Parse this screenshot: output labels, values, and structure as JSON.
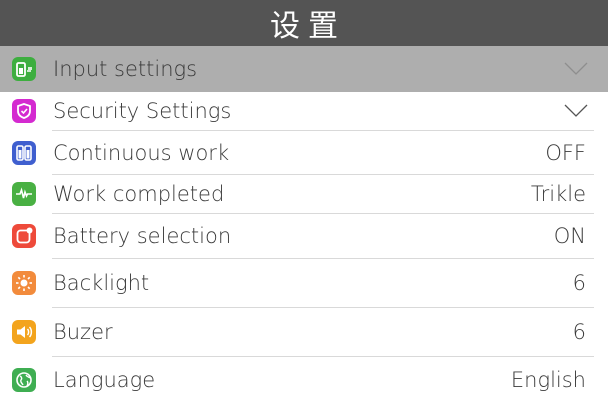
{
  "header": {
    "title": "设置"
  },
  "menu": {
    "items": [
      {
        "label": "Input settings",
        "value": "",
        "icon": "plug-icon",
        "color": "#3dae3f",
        "selected": true,
        "chevron": true
      },
      {
        "label": "Security Settings",
        "value": "",
        "icon": "shield-icon",
        "color": "#d42ad0",
        "selected": false,
        "chevron": true
      },
      {
        "label": "Continuous work",
        "value": "OFF",
        "icon": "battery-pair-icon",
        "color": "#3f5fcf",
        "selected": false,
        "chevron": false
      },
      {
        "label": "Work completed",
        "value": "Trikle",
        "icon": "pulse-icon",
        "color": "#49b043",
        "selected": false,
        "chevron": false
      },
      {
        "label": "Battery selection",
        "value": "ON",
        "icon": "badge-icon",
        "color": "#ee4a3a",
        "selected": false,
        "chevron": false
      },
      {
        "label": "Backlight",
        "value": "6",
        "icon": "sun-icon",
        "color": "#f28b3c",
        "selected": false,
        "chevron": false
      },
      {
        "label": "Buzer",
        "value": "6",
        "icon": "speaker-icon",
        "color": "#f3a41d",
        "selected": false,
        "chevron": false
      },
      {
        "label": "Language",
        "value": "English",
        "icon": "globe-icon",
        "color": "#3fae52",
        "selected": false,
        "chevron": false
      }
    ]
  }
}
